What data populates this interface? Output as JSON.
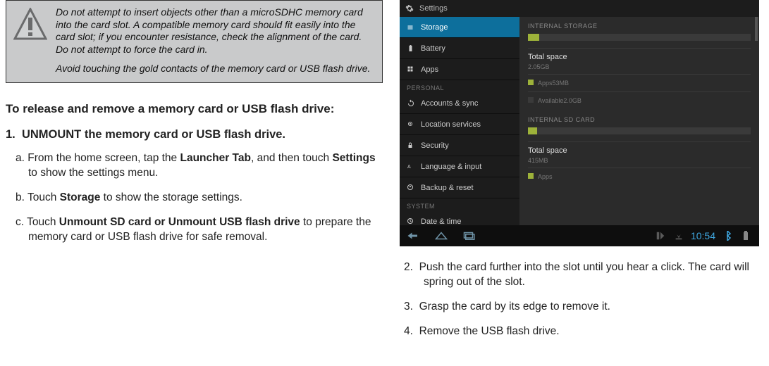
{
  "warning": {
    "p1": "Do not attempt to insert objects other than a microSDHC memory card into the card slot. A compatible memory card should fit easily into the card slot; if you encounter resistance, check the alignment of the card. Do not attempt to force the card in.",
    "p2": "Avoid touching the gold contacts of the memory card or USB flash drive."
  },
  "heading": "To release and remove a memory card or USB flash drive:",
  "step1": {
    "num": "1.",
    "text": "UNMOUNT the memory card or USB flash drive."
  },
  "sub_a": {
    "lead": "a. From the home screen, tap the ",
    "b1": "Launcher Tab",
    "mid": ", and then touch ",
    "b2": "Settings",
    "tail": " to show the settings menu."
  },
  "sub_b": {
    "lead": "b. Touch ",
    "b1": "Storage",
    "tail": " to show the storage settings."
  },
  "sub_c": {
    "lead": "c. Touch ",
    "b1": "Unmount SD card or Unmount USB flash drive",
    "tail": " to prepare the memory card or USB flash drive for safe removal."
  },
  "right_steps": {
    "s2": {
      "num": "2.",
      "text": "Push the card further into the slot until you hear a click. The card will spring out of the slot."
    },
    "s3": {
      "num": "3.",
      "text": "Grasp the card by its edge to remove it."
    },
    "s4": {
      "num": "4.",
      "text": "Remove the USB flash drive."
    }
  },
  "shot": {
    "title": "Settings",
    "side": {
      "storage": "Storage",
      "battery": "Battery",
      "apps": "Apps",
      "personal": "PERSONAL",
      "accounts": "Accounts & sync",
      "location": "Location services",
      "security": "Security",
      "lang": "Language & input",
      "backup": "Backup & reset",
      "system": "SYSTEM",
      "date": "Date & time"
    },
    "main": {
      "internal": "INTERNAL STORAGE",
      "total": "Total space",
      "totalv": "2.05GB",
      "apps": "Apps",
      "appsv": "53MB",
      "avail": "Available",
      "availv": "2.0GB",
      "sd": "INTERNAL SD CARD",
      "total2": "Total space",
      "total2v": "415MB",
      "apps2": "Apps"
    },
    "nav": {
      "time": "10:54"
    }
  }
}
